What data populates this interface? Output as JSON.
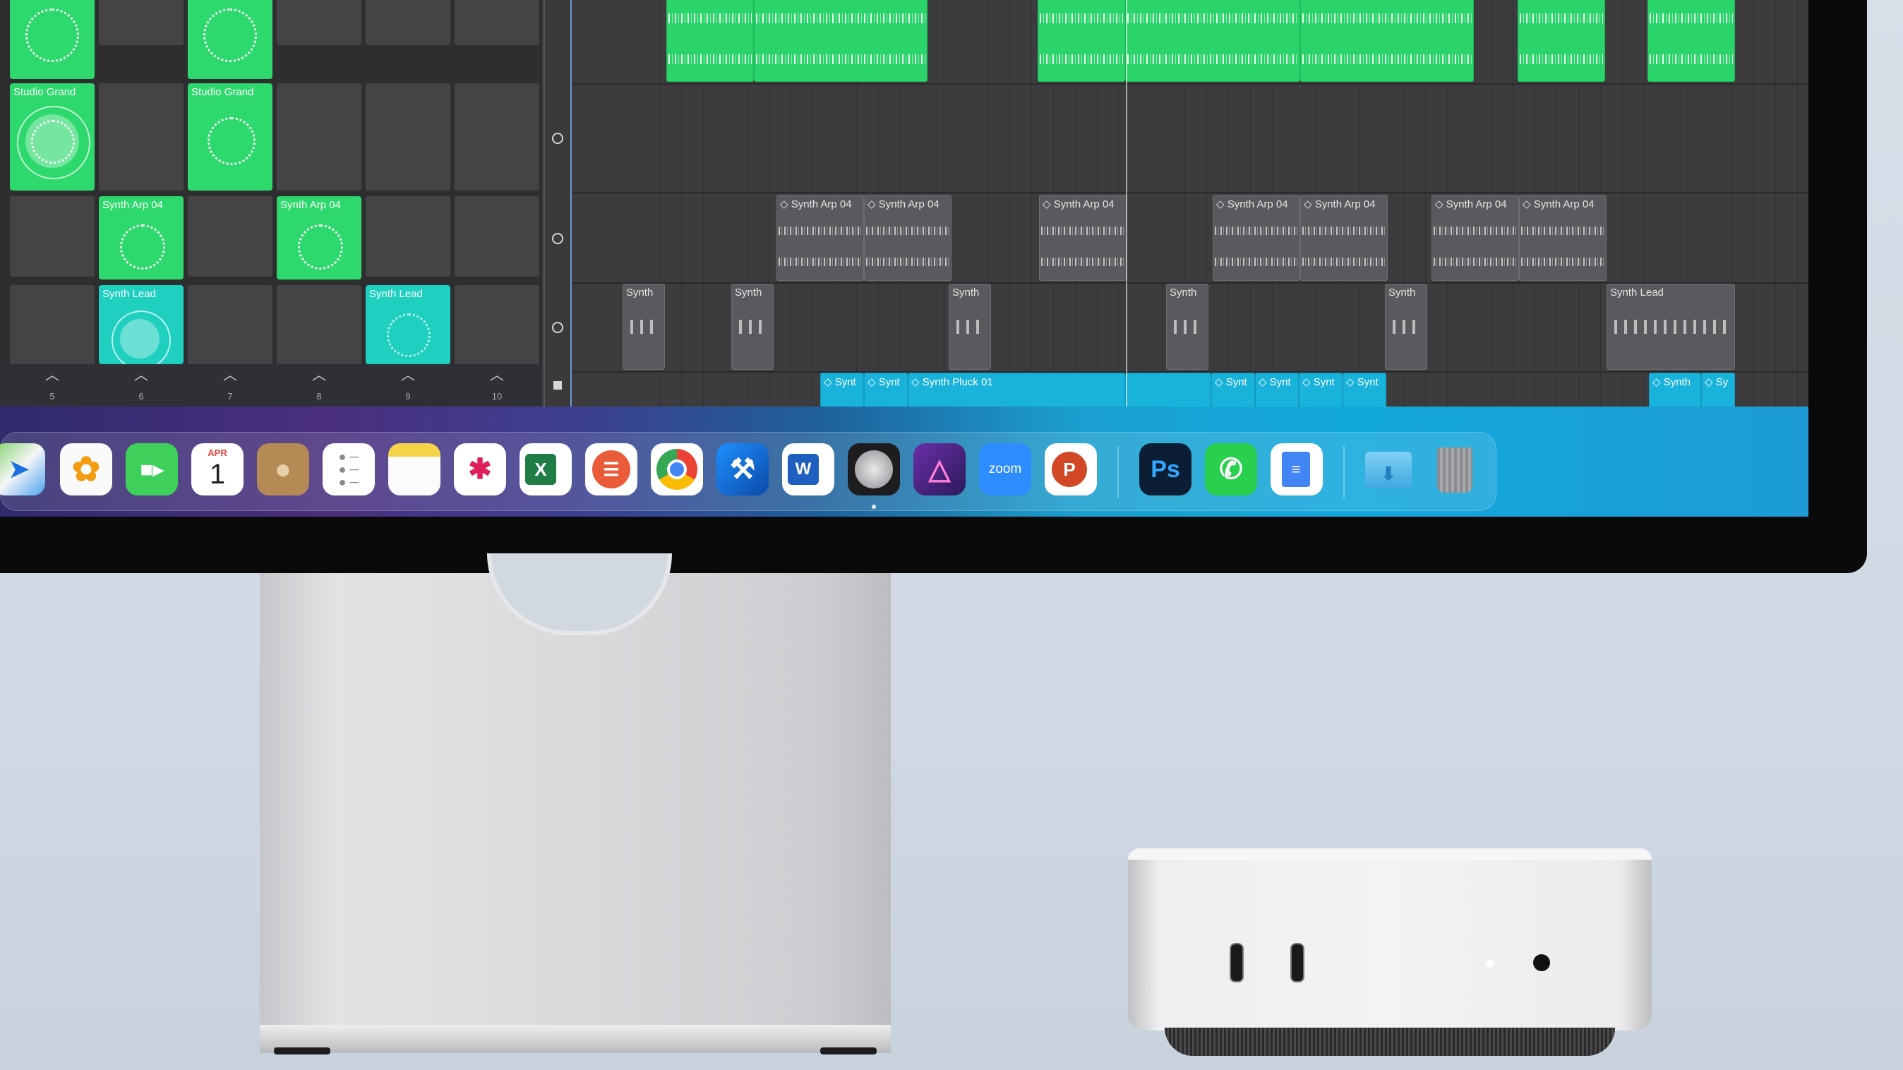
{
  "colors": {
    "clip_green": "#2dd86c",
    "clip_teal": "#1fd0c0",
    "region_blue": "#19b2db",
    "region_gray": "#5a5a5e"
  },
  "live_loops": {
    "cells": [
      {
        "label": "Studio Grand"
      },
      {
        "label": "Studio Grand"
      },
      {
        "label": "Synth Arp 04"
      },
      {
        "label": "Synth Arp 04"
      },
      {
        "label": "Synth Lead"
      },
      {
        "label": "Synth Lead"
      }
    ],
    "column_numbers": [
      "5",
      "6",
      "7",
      "8",
      "9",
      "10"
    ]
  },
  "tracks": {
    "arp_regions": [
      "Synth Arp 04",
      "Synth Arp 04",
      "Synth Arp 04",
      "Synth Arp 04",
      "Synth Arp 04",
      "Synth Arp 04",
      "Synth Arp 04"
    ],
    "synth_regions": [
      "Synth",
      "Synth",
      "Synth",
      "Synth",
      "Synth",
      "Synth Lead"
    ],
    "pluck_regions": [
      "Synt",
      "Synt",
      "Synth Pluck 01",
      "Synt",
      "Synt",
      "Synt",
      "Synt",
      "Synth",
      "Sy"
    ]
  },
  "dock": {
    "apps": [
      {
        "name": "maps-icon"
      },
      {
        "name": "photos-icon"
      },
      {
        "name": "facetime-icon"
      },
      {
        "name": "calendar-icon",
        "month": "APR",
        "day": "1"
      },
      {
        "name": "contacts-icon"
      },
      {
        "name": "reminders-icon"
      },
      {
        "name": "notes-icon"
      },
      {
        "name": "slack-icon"
      },
      {
        "name": "excel-icon",
        "glyph": "X"
      },
      {
        "name": "speaker-deck-icon"
      },
      {
        "name": "chrome-icon"
      },
      {
        "name": "xcode-icon"
      },
      {
        "name": "word-icon",
        "glyph": "W"
      },
      {
        "name": "logic-pro-icon"
      },
      {
        "name": "affinity-photo-icon"
      },
      {
        "name": "zoom-icon",
        "glyph": "zoom"
      },
      {
        "name": "powerpoint-icon",
        "glyph": "P"
      },
      {
        "name": "photoshop-icon",
        "glyph": "Ps"
      },
      {
        "name": "whatsapp-icon"
      },
      {
        "name": "google-docs-icon"
      },
      {
        "name": "downloads-folder-icon"
      },
      {
        "name": "trash-icon"
      }
    ]
  }
}
